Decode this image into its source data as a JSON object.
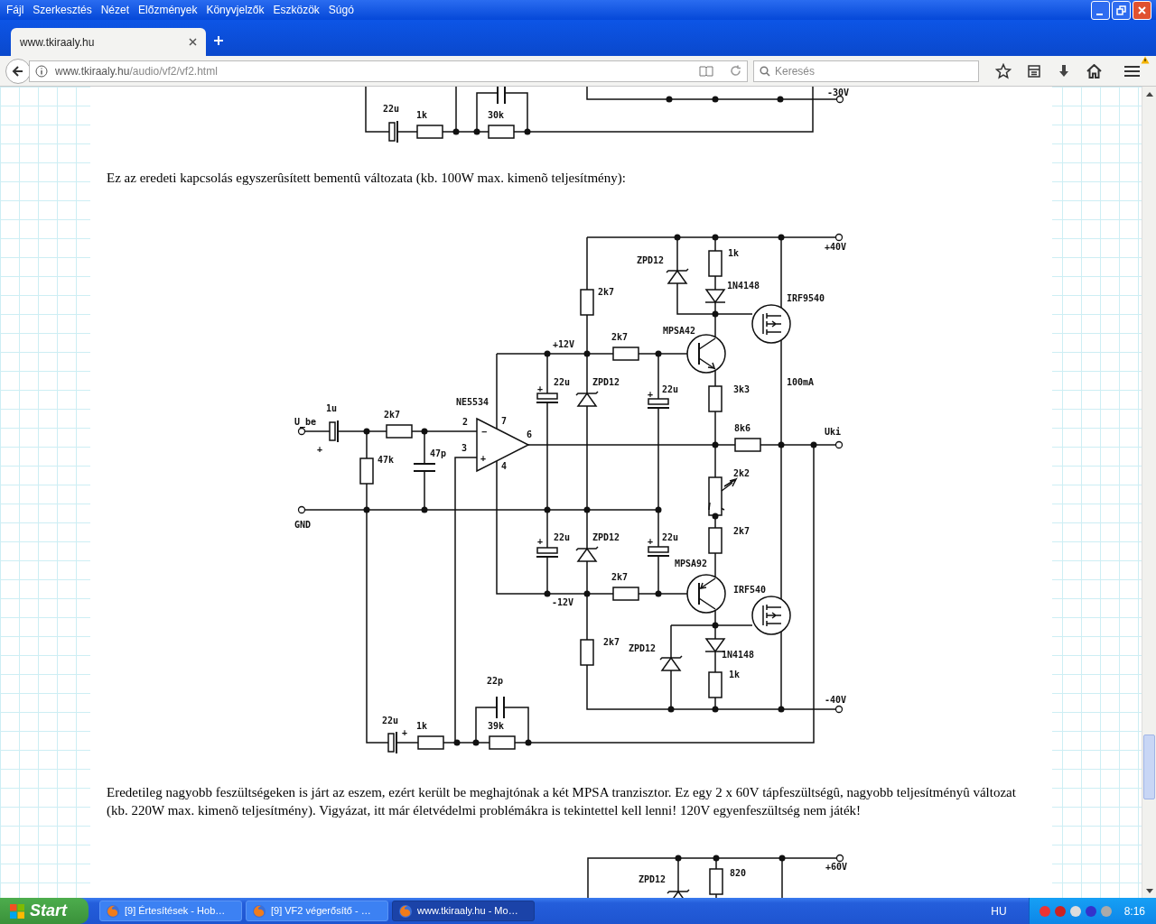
{
  "menu_bar": [
    "Fájl",
    "Szerkesztés",
    "Nézet",
    "Előzmények",
    "Könyvjelzők",
    "Eszközök",
    "Súgó"
  ],
  "tabs": [
    {
      "label": "www.tkiraaly.hu",
      "selected": true
    }
  ],
  "address_bar": {
    "url_host": "www.tkiraaly.hu",
    "url_path": "/audio/vf2/vf2.html"
  },
  "search": {
    "placeholder": "Keresés"
  },
  "page": {
    "top_schematic": {
      "labels": [
        "22u",
        "1k",
        "30k",
        "-30V"
      ]
    },
    "paragraphs": [
      "Ez az eredeti kapcsolás egyszerûsített bementû változata (kb. 100W max. kimenõ teljesítmény):",
      "Eredetileg nagyobb feszültségeken is járt az eszem, ezért került be meghajtónak a két MPSA tranzisztor. Ez egy 2 x 60V tápfeszültségû, nagyobb teljesítményû változat (kb. 220W max. kimenõ teljesítmény). Vigyázat, itt már életvédelmi problémákra is tekintettel kell lenni! 120V egyenfeszültség nem játék!"
    ],
    "main_schematic": {
      "labels": [
        "ZPD12",
        "1k",
        "+40V",
        "1N4148",
        "IRF9540",
        "2k7",
        "MPSA42",
        "+12V",
        "2k7",
        "22u",
        "ZPD12",
        "22u",
        "3k3",
        "100mA",
        "NE5534",
        "1u",
        "2k7",
        "U_be",
        "2",
        "7",
        "6",
        "3",
        "8k6",
        "Uki",
        "+",
        "47k",
        "47p",
        "4",
        "2k2",
        "GND",
        "2k7",
        "22u",
        "ZPD12",
        "22u",
        "MPSA92",
        "2k7",
        "IRF540",
        "-12V",
        "2k7",
        "ZPD12",
        "1N4148",
        "1k",
        "-40V",
        "22p",
        "22u",
        "1k",
        "39k",
        "+",
        "+",
        "+",
        "+",
        "+",
        "−",
        "+"
      ]
    },
    "bottom_schematic": {
      "labels": [
        "ZPD12",
        "820",
        "+60V"
      ]
    }
  },
  "taskbar": {
    "start": "Start",
    "tasks": [
      {
        "label": "[9] Értesítések - Hob…",
        "selected": false
      },
      {
        "label": "[9] VF2 végerősítő - …",
        "selected": false
      },
      {
        "label": "www.tkiraaly.hu - Mo…",
        "selected": true
      }
    ],
    "language": "HU",
    "clock": "8:16"
  }
}
